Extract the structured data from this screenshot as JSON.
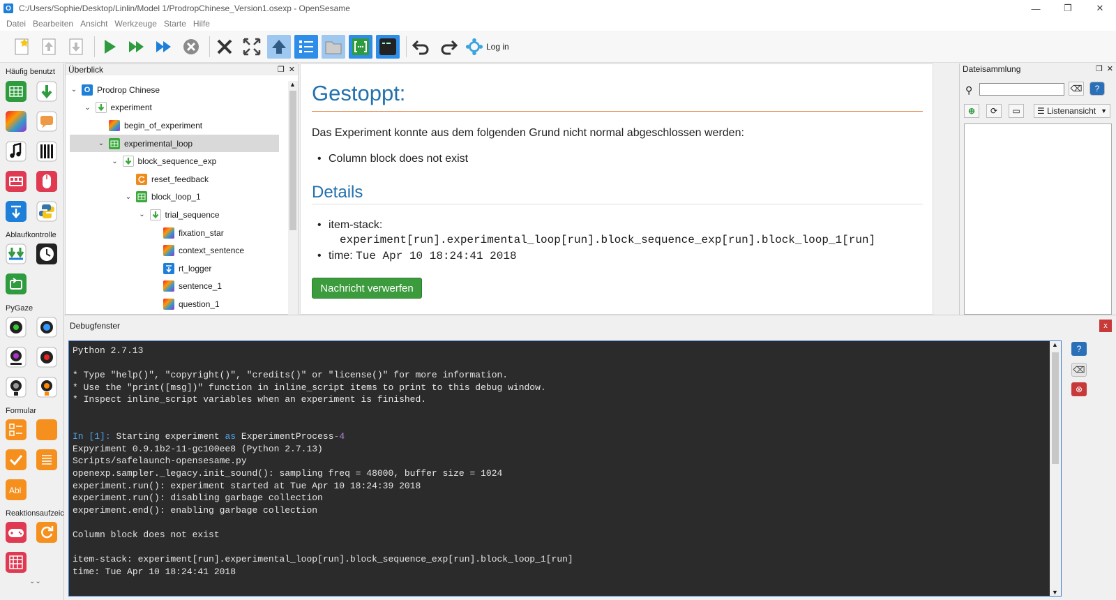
{
  "window": {
    "title": "C:/Users/Sophie/Desktop/Linlin/Model 1/ProdropChinese_Version1.osexp - OpenSesame",
    "app_icon": "O"
  },
  "menu": [
    "Datei",
    "Bearbeiten",
    "Ansicht",
    "Werkzeuge",
    "Starte",
    "Hilfe"
  ],
  "toolbar": {
    "login_label": "Log in",
    "icons": [
      "new-file-icon",
      "open-file-icon",
      "save-file-icon",
      "run-icon",
      "run-fast-icon",
      "run-quick-icon",
      "stop-icon",
      "close-all-icon",
      "fullscreen-icon",
      "upload-icon",
      "overview-icon",
      "file-pool-icon",
      "variables-icon",
      "debug-window-icon",
      "undo-icon",
      "redo-icon",
      "osf-icon"
    ]
  },
  "palette": {
    "categories": [
      "Häufig benutzt",
      "Ablaufkontrolle",
      "PyGaze",
      "Formular",
      "Reaktionsaufzeichn"
    ],
    "more": "⌄⌄"
  },
  "overview": {
    "title": "Überblick",
    "tree": [
      {
        "label": "Prodrop Chinese",
        "depth": 0,
        "expanded": true,
        "icon": "opensesame-icon",
        "color": "#1d7fd8"
      },
      {
        "label": "experiment",
        "depth": 1,
        "expanded": true,
        "icon": "sequence-icon",
        "color": "#3aa83a"
      },
      {
        "label": "begin_of_experiment",
        "depth": 2,
        "expanded": null,
        "icon": "sketchpad-icon",
        "color": "#c84a8a"
      },
      {
        "label": "experimental_loop",
        "depth": 2,
        "expanded": true,
        "icon": "loop-icon",
        "color": "#3aa83a",
        "selected": true
      },
      {
        "label": "block_sequence_exp",
        "depth": 3,
        "expanded": true,
        "icon": "sequence-icon",
        "color": "#3aa83a"
      },
      {
        "label": "reset_feedback",
        "depth": 4,
        "expanded": null,
        "icon": "reset-feedback-icon",
        "color": "#f08a1a"
      },
      {
        "label": "block_loop_1",
        "depth": 4,
        "expanded": true,
        "icon": "loop-icon",
        "color": "#3aa83a"
      },
      {
        "label": "trial_sequence",
        "depth": 5,
        "expanded": true,
        "icon": "sequence-icon",
        "color": "#3aa83a"
      },
      {
        "label": "fixation_star",
        "depth": 6,
        "expanded": null,
        "icon": "sketchpad-icon",
        "color": "#c84a8a"
      },
      {
        "label": "context_sentence",
        "depth": 6,
        "expanded": null,
        "icon": "sketchpad-icon",
        "color": "#c84a8a"
      },
      {
        "label": "rt_logger",
        "depth": 6,
        "expanded": null,
        "icon": "logger-icon",
        "color": "#1d7fd8"
      },
      {
        "label": "sentence_1",
        "depth": 6,
        "expanded": null,
        "icon": "sketchpad-icon",
        "color": "#c84a8a"
      },
      {
        "label": "question_1",
        "depth": 6,
        "expanded": null,
        "icon": "sketchpad-icon",
        "color": "#c84a8a"
      }
    ]
  },
  "main": {
    "title": "Gestoppt:",
    "message": "Das Experiment konnte aus dem folgenden Grund nicht normal abgeschlossen werden:",
    "reason": "Column block does not exist",
    "details_title": "Details",
    "item_stack_label": "item-stack:",
    "item_stack_value": "experiment[run].experimental_loop[run].block_sequence_exp[run].block_loop_1[run]",
    "time_label": "time:",
    "time_value": "Tue Apr 10 18:24:41 2018",
    "dismiss_label": "Nachricht verwerfen"
  },
  "filepool": {
    "title": "Dateisammlung",
    "search_value": "",
    "view_label": "Listenansicht"
  },
  "debug": {
    "title": "Debugfenster",
    "lines": [
      "Python 2.7.13",
      "",
      "* Type \"help()\", \"copyright()\", \"credits()\" or \"license()\" for more information.",
      "* Use the \"print([msg])\" function in inline_script items to print to this debug window.",
      "* Inspect inline_script variables when an experiment is finished.",
      "",
      "",
      "In [1]: Starting experiment as ExperimentProcess-4",
      "Expyriment 0.9.1b2-11-gc100ee8 (Python 2.7.13)",
      "Scripts/safelaunch-opensesame.py",
      "openexp.sampler._legacy.init_sound(): sampling freq = 48000, buffer size = 1024",
      "experiment.run(): experiment started at Tue Apr 10 18:24:39 2018",
      "experiment.run(): disabling garbage collection",
      "experiment.end(): enabling garbage collection",
      "",
      "Column block does not exist",
      "",
      "item-stack: experiment[run].experimental_loop[run].block_sequence_exp[run].block_loop_1[run]",
      "time: Tue Apr 10 18:24:41 2018"
    ]
  },
  "colors": {
    "accent": "#2271ad",
    "stop_rule": "#e07c3e",
    "dismiss_button": "#3c9b3c",
    "console_bg": "#2b2b2b"
  }
}
